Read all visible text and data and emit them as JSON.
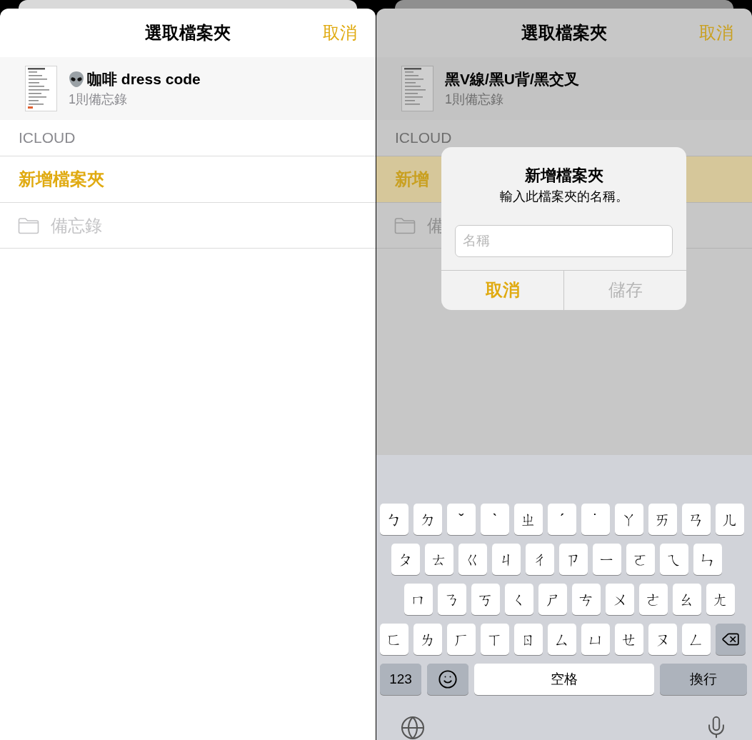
{
  "screens": [
    {
      "dimmed": false,
      "title": "選取檔案夾",
      "cancel": "取消",
      "note": {
        "title": "咖啡 dress code",
        "emoji": true,
        "count": "1則備忘錄"
      },
      "section": "ICLOUD",
      "new_folder": {
        "label": "新增檔案夾",
        "highlighted": false
      },
      "folders": [
        {
          "name": "備忘錄",
          "disabled": true
        }
      ]
    },
    {
      "dimmed": true,
      "title": "選取檔案夾",
      "cancel": "取消",
      "note": {
        "title": "黑V線/黑U背/黑交叉",
        "emoji": false,
        "count": "1則備忘錄"
      },
      "section": "ICLOUD",
      "new_folder": {
        "label": "新增",
        "highlighted": true
      },
      "folders": [
        {
          "name": "備",
          "disabled": true
        }
      ],
      "dialog": {
        "title": "新增檔案夾",
        "message": "輸入此檔案夾的名稱。",
        "field": {
          "placeholder": "名稱"
        },
        "buttons": [
          {
            "label": "取消",
            "kind": "cancel",
            "disabled": false
          },
          {
            "label": "儲存",
            "kind": "save",
            "disabled": true
          }
        ]
      },
      "keyboard": {
        "rows": [
          {
            "keys": [
              {
                "kind": "letter",
                "label": "ㄅ"
              },
              {
                "kind": "letter",
                "label": "ㄉ"
              },
              {
                "kind": "letter",
                "label": "ˇ"
              },
              {
                "kind": "letter",
                "label": "ˋ"
              },
              {
                "kind": "letter",
                "label": "ㄓ"
              },
              {
                "kind": "letter",
                "label": "ˊ"
              },
              {
                "kind": "letter",
                "label": "˙"
              },
              {
                "kind": "letter",
                "label": "ㄚ"
              },
              {
                "kind": "letter",
                "label": "ㄞ"
              },
              {
                "kind": "letter",
                "label": "ㄢ"
              },
              {
                "kind": "letter",
                "label": "ㄦ"
              }
            ]
          },
          {
            "keys": [
              {
                "kind": "letter",
                "label": "ㄆ"
              },
              {
                "kind": "letter",
                "label": "ㄊ"
              },
              {
                "kind": "letter",
                "label": "ㄍ"
              },
              {
                "kind": "letter",
                "label": "ㄐ"
              },
              {
                "kind": "letter",
                "label": "ㄔ"
              },
              {
                "kind": "letter",
                "label": "ㄗ"
              },
              {
                "kind": "letter",
                "label": "ㄧ"
              },
              {
                "kind": "letter",
                "label": "ㄛ"
              },
              {
                "kind": "letter",
                "label": "ㄟ"
              },
              {
                "kind": "letter",
                "label": "ㄣ"
              }
            ]
          },
          {
            "keys": [
              {
                "kind": "letter",
                "label": "ㄇ"
              },
              {
                "kind": "letter",
                "label": "ㄋ"
              },
              {
                "kind": "letter",
                "label": "ㄎ"
              },
              {
                "kind": "letter",
                "label": "ㄑ"
              },
              {
                "kind": "letter",
                "label": "ㄕ"
              },
              {
                "kind": "letter",
                "label": "ㄘ"
              },
              {
                "kind": "letter",
                "label": "ㄨ"
              },
              {
                "kind": "letter",
                "label": "ㄜ"
              },
              {
                "kind": "letter",
                "label": "ㄠ"
              },
              {
                "kind": "letter",
                "label": "ㄤ"
              }
            ]
          },
          {
            "keys": [
              {
                "kind": "letter",
                "label": "ㄈ"
              },
              {
                "kind": "letter",
                "label": "ㄌ"
              },
              {
                "kind": "letter",
                "label": "ㄏ"
              },
              {
                "kind": "letter",
                "label": "ㄒ"
              },
              {
                "kind": "letter",
                "label": "ㄖ"
              },
              {
                "kind": "letter",
                "label": "ㄙ"
              },
              {
                "kind": "letter",
                "label": "ㄩ"
              },
              {
                "kind": "letter",
                "label": "ㄝ"
              },
              {
                "kind": "letter",
                "label": "ㄡ"
              },
              {
                "kind": "letter",
                "label": "ㄥ"
              },
              {
                "kind": "delete"
              }
            ]
          },
          {
            "keys": [
              {
                "kind": "numbers",
                "label": "123"
              },
              {
                "kind": "emoji"
              },
              {
                "kind": "space",
                "label": "空格"
              },
              {
                "kind": "return",
                "label": "換行"
              }
            ]
          }
        ]
      }
    }
  ]
}
